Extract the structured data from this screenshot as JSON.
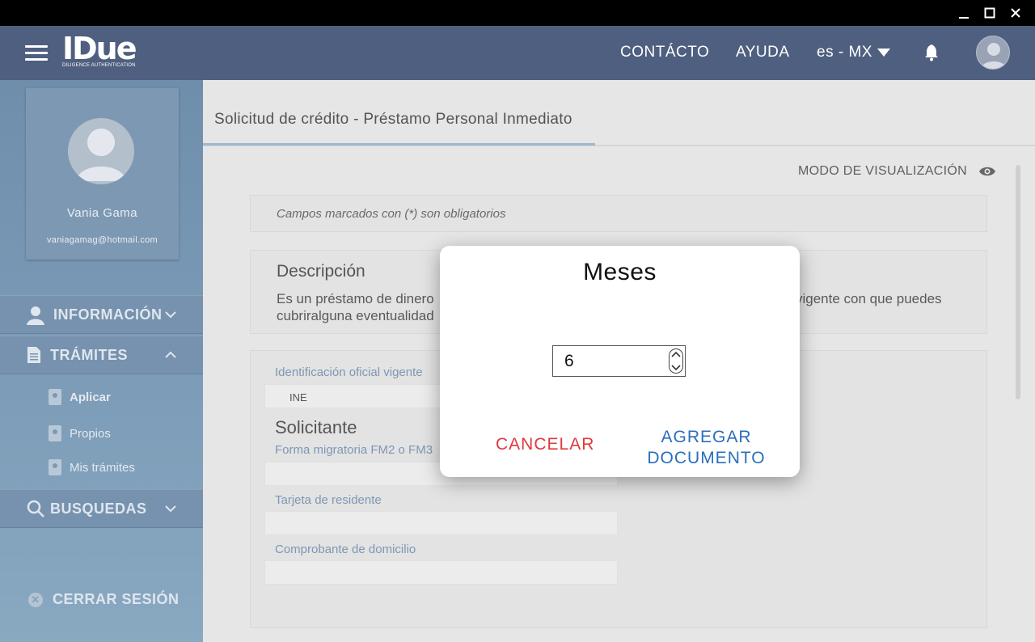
{
  "window": {
    "minimize": "—",
    "maximize": "☐",
    "close": "✕"
  },
  "header": {
    "logo_main": "IDue",
    "logo_sub": "DILIGENCE AUTHENTICATION",
    "nav_contacto": "CONTÁCTO",
    "nav_ayuda": "AYUDA",
    "lang": "es - MX",
    "icons": [
      "menu-icon",
      "bell-icon",
      "user-avatar-icon",
      "caret-down-icon"
    ]
  },
  "sidebar": {
    "user_name": "Vania Gama",
    "user_email": "vaniagamag@hotmail.com",
    "sections": {
      "informacion": "INFORMACIÓN",
      "tramites": "TRÁMITES",
      "busquedas": "BUSQUEDAS"
    },
    "items": {
      "aplicar": "Aplicar",
      "propios": "Propios",
      "mis_tramites": "Mis trámites"
    },
    "logout": "CERRAR SESIÓN"
  },
  "main": {
    "tab_title": "Solicitud de crédito  - Préstamo Personal Inmediato",
    "view_mode": "MODO DE VISUALIZACIÓN",
    "required_note": "Campos marcados con (*) son obligatorios",
    "description_title": "Descripción",
    "description_line1": "Es un préstamo de dinero",
    "description_line1b": "vigente con que puedes",
    "description_line2": "cubriralguna eventualidad",
    "form": {
      "id_label": "Identificación oficial vigente",
      "id_value": "INE",
      "solicitante": "Solicitante",
      "fm_label": "Forma migratoria FM2 o FM3",
      "resident_label": "Tarjeta de residente",
      "address_label": "Comprobante de domicilio"
    }
  },
  "modal": {
    "title": "Meses",
    "value": "6",
    "cancel": "CANCELAR",
    "add_line1": "AGREGAR",
    "add_line2": "DOCUMENTO"
  }
}
